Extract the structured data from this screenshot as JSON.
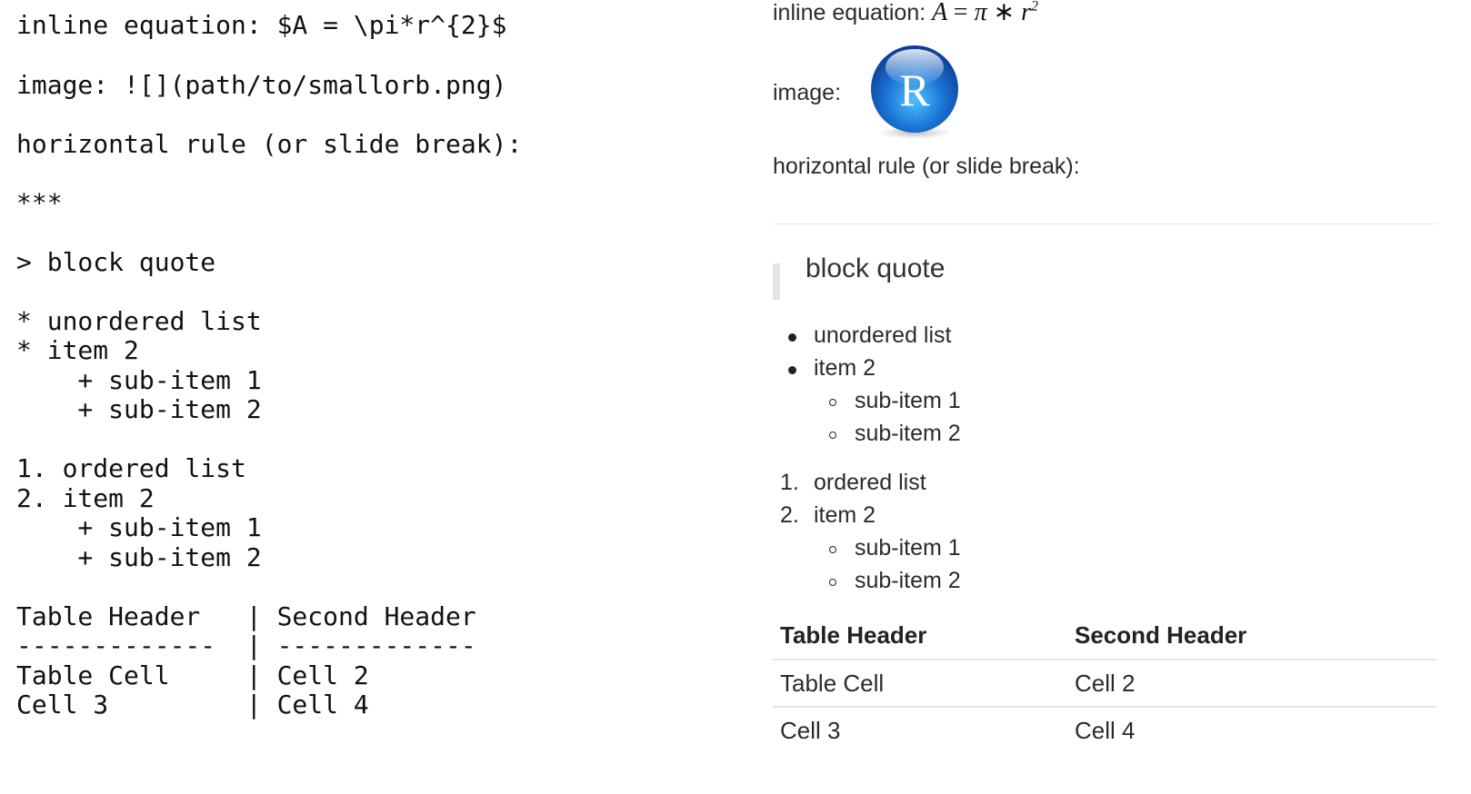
{
  "source": {
    "lines": [
      "inline equation: $A = \\pi*r^{2}$",
      "image: ![](path/to/smallorb.png)",
      "horizontal rule (or slide break):",
      "***",
      "> block quote",
      "* unordered list",
      "* item 2",
      "    + sub-item 1",
      "    + sub-item 2",
      "1. ordered list",
      "2. item 2",
      "    + sub-item 1",
      "    + sub-item 2",
      "Table Header   | Second Header",
      "-------------  | -------------",
      "Table Cell     | Cell 2",
      "Cell 3         | Cell 4"
    ]
  },
  "rendered": {
    "equation": {
      "label": "inline equation:",
      "var_a": "A",
      "equals": "=",
      "pi": "π",
      "times": "∗",
      "var_r": "r",
      "exponent": "2"
    },
    "image": {
      "label": "image:",
      "logo_letter": "R"
    },
    "hr_label": "horizontal rule (or slide break):",
    "blockquote": "block quote",
    "unordered": {
      "items": [
        "unordered list",
        "item 2"
      ],
      "subitems": [
        "sub-item 1",
        "sub-item 2"
      ]
    },
    "ordered": {
      "numbers": [
        "1.",
        "2."
      ],
      "items": [
        "ordered list",
        "item 2"
      ],
      "subitems": [
        "sub-item 1",
        "sub-item 2"
      ]
    },
    "table": {
      "headers": [
        "Table Header",
        "Second Header"
      ],
      "rows": [
        [
          "Table Cell",
          "Cell 2"
        ],
        [
          "Cell 3",
          "Cell 4"
        ]
      ]
    }
  }
}
